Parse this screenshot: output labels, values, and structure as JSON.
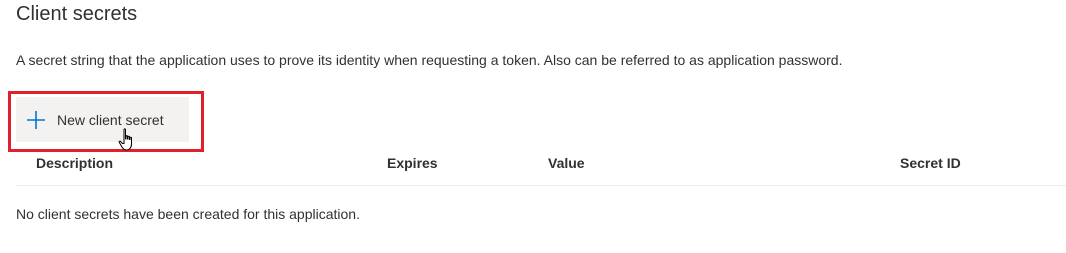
{
  "section": {
    "title": "Client secrets",
    "description": "A secret string that the application uses to prove its identity when requesting a token. Also can be referred to as application password."
  },
  "toolbar": {
    "new_button_label": "New client secret",
    "new_button_icon": "plus-icon",
    "highlight_color": "#e0202b",
    "accent_color": "#0078d4"
  },
  "table": {
    "columns": [
      "Description",
      "Expires",
      "Value",
      "Secret ID"
    ],
    "empty_message": "No client secrets have been created for this application."
  }
}
